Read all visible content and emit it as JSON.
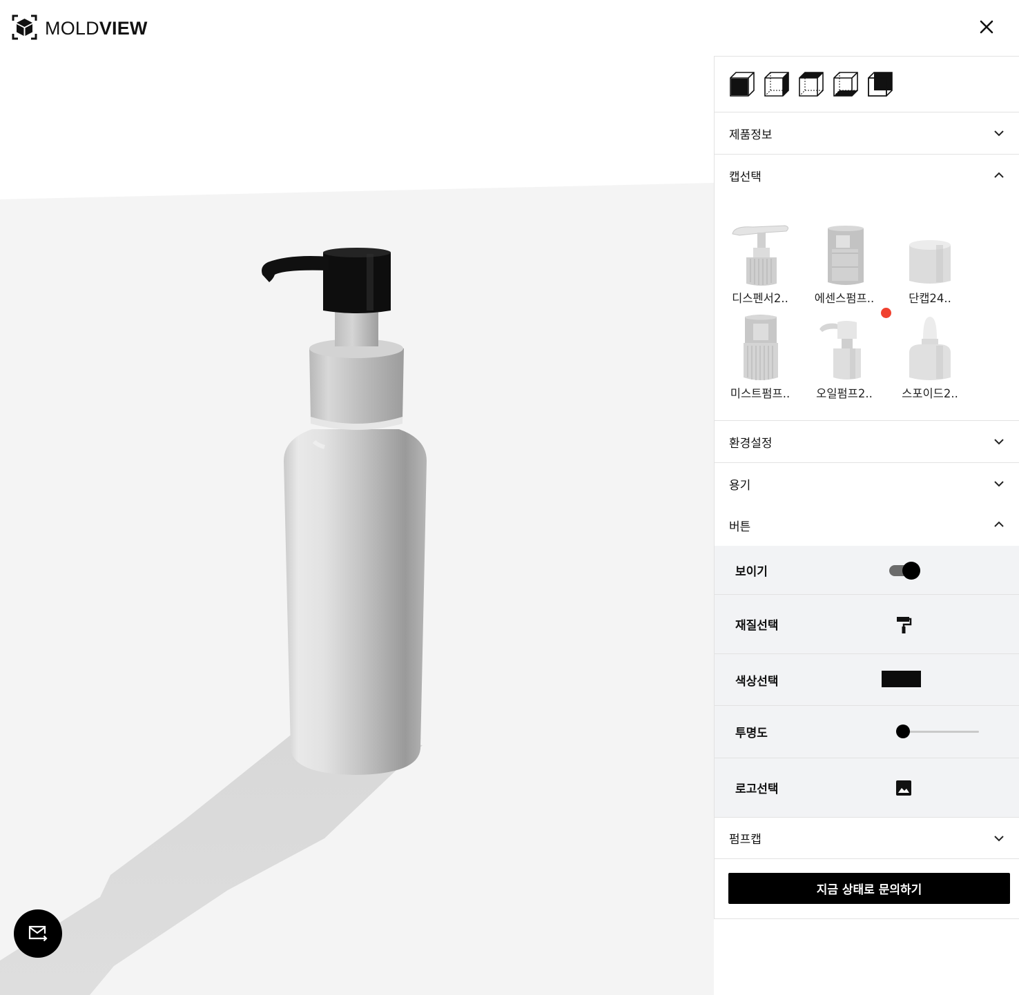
{
  "brand": {
    "name_light": "MOLD",
    "name_bold": "VIEW"
  },
  "header": {
    "close_icon": "close-icon"
  },
  "panel": {
    "view_buttons": [
      "front-view-icon",
      "right-view-icon",
      "top-view-icon",
      "bottom-view-icon",
      "back-view-icon"
    ],
    "sections": {
      "product_info": "제품정보",
      "cap_select": "캡선택",
      "environment": "환경설정",
      "container": "용기",
      "button": "버튼",
      "pump_cap": "펌프캡"
    },
    "caps": [
      {
        "label": "디스펜서2..",
        "icon": "dispenser-cap"
      },
      {
        "label": "에센스펌프..",
        "icon": "essence-pump-cap"
      },
      {
        "label": "단캡24..",
        "icon": "plain-cap"
      },
      {
        "label": "미스트펌프..",
        "icon": "mist-pump-cap"
      },
      {
        "label": "오일펌프2..",
        "icon": "oil-pump-cap"
      },
      {
        "label": "스포이드2..",
        "icon": "dropper-cap"
      }
    ],
    "button_props": {
      "visible_label": "보이기",
      "visible": true,
      "material_label": "재질선택",
      "color_label": "색상선택",
      "color_value": "#0c0c0c",
      "opacity_label": "투명도",
      "opacity_value": 0,
      "logo_label": "로고선택"
    },
    "cta_label": "지금 상태로 문의하기"
  },
  "fab": {
    "icon": "mail-send-icon"
  },
  "colors": {
    "accent": "#000000",
    "notification": "#f0412f",
    "panel_bg": "#f2f3f5"
  }
}
